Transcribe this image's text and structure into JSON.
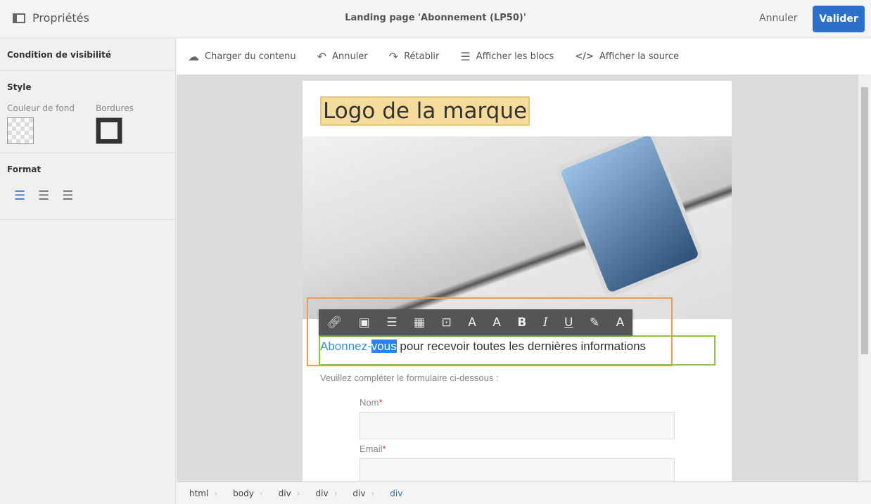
{
  "header": {
    "panel_label": "Propriétés",
    "title": "Landing page 'Abonnement (LP50)'",
    "cancel_label": "Annuler",
    "validate_label": "Valider"
  },
  "sidebar": {
    "visibility": "Condition de visibilité",
    "style": "Style",
    "bg_color": "Couleur de fond",
    "borders": "Bordures",
    "format": "Format"
  },
  "toolbar": {
    "load": "Charger du contenu",
    "undo": "Annuler",
    "redo": "Rétablir",
    "blocks": "Afficher les blocs",
    "source": "Afficher la source"
  },
  "content": {
    "logo": "Logo de la marque",
    "headline_link": "Abonnez-",
    "headline_selected": "vous",
    "headline_rest": " pour recevoir toutes les dernières informations",
    "instructions": "Veuillez compléter le formulaire ci-dessous :",
    "name_label": "Nom",
    "email_label": "Email",
    "required": "*"
  },
  "breadcrumb": [
    "html",
    "body",
    "div",
    "div",
    "div",
    "div"
  ],
  "colors": {
    "accent": "#2d70c9",
    "selection_orange": "#f49b49",
    "selection_green": "#8dc63f"
  }
}
